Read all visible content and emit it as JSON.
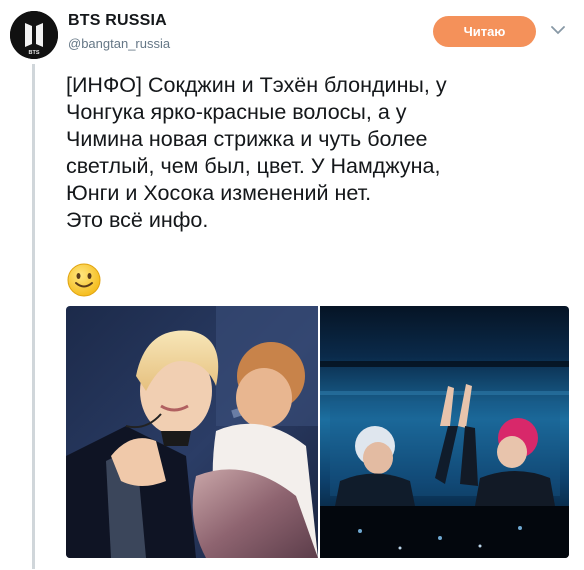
{
  "account": {
    "display_name": "BTS RUSSIA",
    "handle": "@bangtan_russia",
    "avatar_text": "BTS"
  },
  "follow_button": {
    "label": "Читаю"
  },
  "tweet": {
    "lines": [
      "[ИНФО] Сокджин и Тэхён блондины, у",
      "Чонгука ярко-красные волосы, а у",
      "Чимина новая стрижка и чуть более",
      "светлый, чем был, цвет. У Намджуна,",
      "Юнги и Хосока изменений нет.",
      "Это всё инфо."
    ],
    "emoji": "slightly-smiling-face"
  },
  "media": {
    "photos": [
      {
        "subject": "concert-photo-stage-closeup"
      },
      {
        "subject": "concert-photo-screen-high-five"
      }
    ]
  },
  "colors": {
    "follow_button": "#f4915a",
    "handle": "#657786",
    "thread_line": "#d0d6da",
    "text": "#14171a"
  }
}
